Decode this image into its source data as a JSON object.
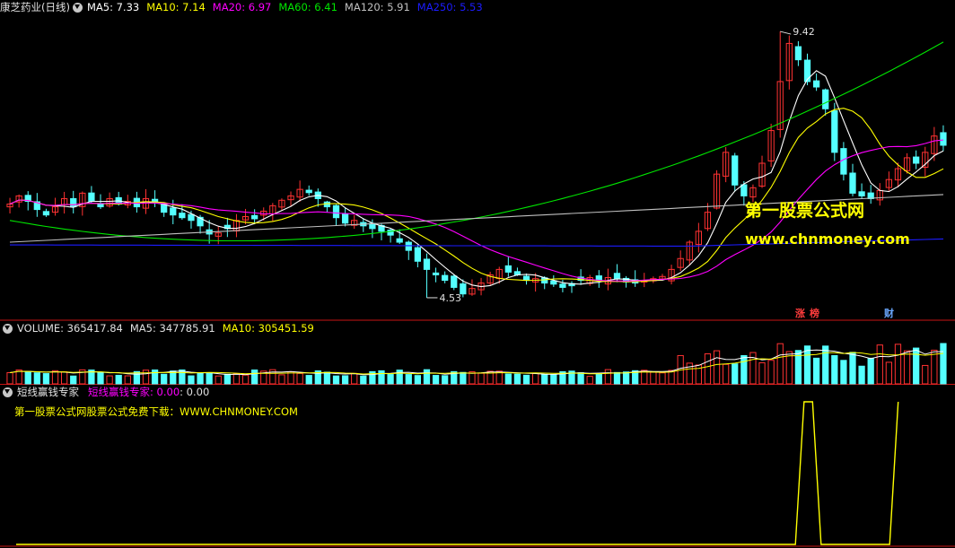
{
  "main_header": {
    "title": "康芝药业(日线)",
    "ma5": "MA5: 7.33",
    "ma10": "MA10: 7.14",
    "ma20": "MA20: 6.97",
    "ma60": "MA60: 6.41",
    "ma120": "MA120: 5.91",
    "ma250": "MA250: 5.53"
  },
  "volume_header": {
    "volume": "VOLUME: 365417.84",
    "ma5": "MA5: 347785.91",
    "ma10": "MA10: 305451.59"
  },
  "indicator_header": {
    "name": "短线赢钱专家",
    "value_label": "短线赢钱专家: 0.00",
    "value2": ": 0.00"
  },
  "indicator_note": "第一股票公式网股票公式免费下载：WWW.CHNMONEY.COM",
  "watermark": {
    "line1": "第一股票公式网",
    "line2": "www.chnmoney.com"
  },
  "tags": {
    "t1": "涨",
    "t2": "榜",
    "t3": "财"
  },
  "colors": {
    "up": "#ff3232",
    "down": "#54ffff",
    "ma5": "#ffffff",
    "ma10": "#ffff00",
    "ma20": "#ff00ff",
    "ma60": "#00e600",
    "ma120": "#c0c0c0",
    "ma250": "#1c1cff",
    "divider": "#c81414",
    "indicator": "#ffff00"
  },
  "chart_data": [
    {
      "type": "candlestick",
      "title": "康芝药业(日线)",
      "ylim": [
        4.2,
        9.8
      ],
      "annotations": [
        {
          "label": "9.42",
          "value": 9.42,
          "bar": 85
        },
        {
          "label": "4.53",
          "value": 4.53,
          "bar": 46
        }
      ],
      "close": [
        6.25,
        6.4,
        6.3,
        6.15,
        6.05,
        6.2,
        6.35,
        6.2,
        6.45,
        6.3,
        6.2,
        6.35,
        6.25,
        6.3,
        6.2,
        6.35,
        6.28,
        6.1,
        6.05,
        6.0,
        5.95,
        5.85,
        5.7,
        5.72,
        5.8,
        5.95,
        6.02,
        5.98,
        6.12,
        6.22,
        6.32,
        6.4,
        6.52,
        6.46,
        6.35,
        6.2,
        6.0,
        5.9,
        5.95,
        5.85,
        5.8,
        5.75,
        5.68,
        5.55,
        5.4,
        5.2,
        5.05,
        4.95,
        4.85,
        4.72,
        4.6,
        4.7,
        4.8,
        4.95,
        5.05,
        5.0,
        4.95,
        4.85,
        4.88,
        4.8,
        4.78,
        4.72,
        4.75,
        4.85,
        4.9,
        4.85,
        4.9,
        4.88,
        4.82,
        4.8,
        4.85,
        4.88,
        4.92,
        5.05,
        5.25,
        5.55,
        5.75,
        6.1,
        6.8,
        7.2,
        6.6,
        6.4,
        6.55,
        7.0,
        7.6,
        8.5,
        9.2,
        8.9,
        8.5,
        8.4,
        8.0,
        7.2,
        6.8,
        6.45,
        6.4,
        6.35,
        6.5,
        6.7,
        6.9,
        7.1,
        7.0,
        7.2,
        7.5,
        7.33
      ],
      "ma_series": [
        "MA5",
        "MA10",
        "MA20",
        "MA60",
        "MA120",
        "MA250"
      ]
    },
    {
      "type": "bar",
      "title": "VOLUME",
      "series": [
        {
          "name": "VOLUME"
        },
        {
          "name": "MA5"
        },
        {
          "name": "MA10"
        }
      ],
      "ylim": [
        0,
        420000
      ]
    },
    {
      "type": "line",
      "title": "短线赢钱专家",
      "ylim": [
        0,
        1
      ],
      "signals": [
        {
          "start": 92,
          "end": 93,
          "value": 1
        },
        {
          "start": 103,
          "end": 104,
          "value": 1
        }
      ]
    }
  ]
}
